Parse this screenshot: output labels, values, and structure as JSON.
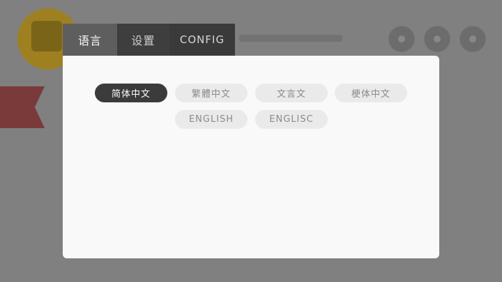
{
  "tabs": [
    {
      "label": "语言",
      "active": true
    },
    {
      "label": "设置",
      "active": false
    },
    {
      "label": "CONFIG",
      "active": false
    }
  ],
  "languages": [
    {
      "label": "简体中文",
      "selected": true
    },
    {
      "label": "繁體中文",
      "selected": false
    },
    {
      "label": "文言文",
      "selected": false
    },
    {
      "label": "梗体中文",
      "selected": false
    },
    {
      "label": "ENGLISH",
      "selected": false
    },
    {
      "label": "ENGLISC",
      "selected": false
    }
  ],
  "colors": {
    "overlay": "#808080",
    "panel": "#f9f9f9",
    "selected_button": "#3b3b3b",
    "button": "#eaeaea"
  }
}
